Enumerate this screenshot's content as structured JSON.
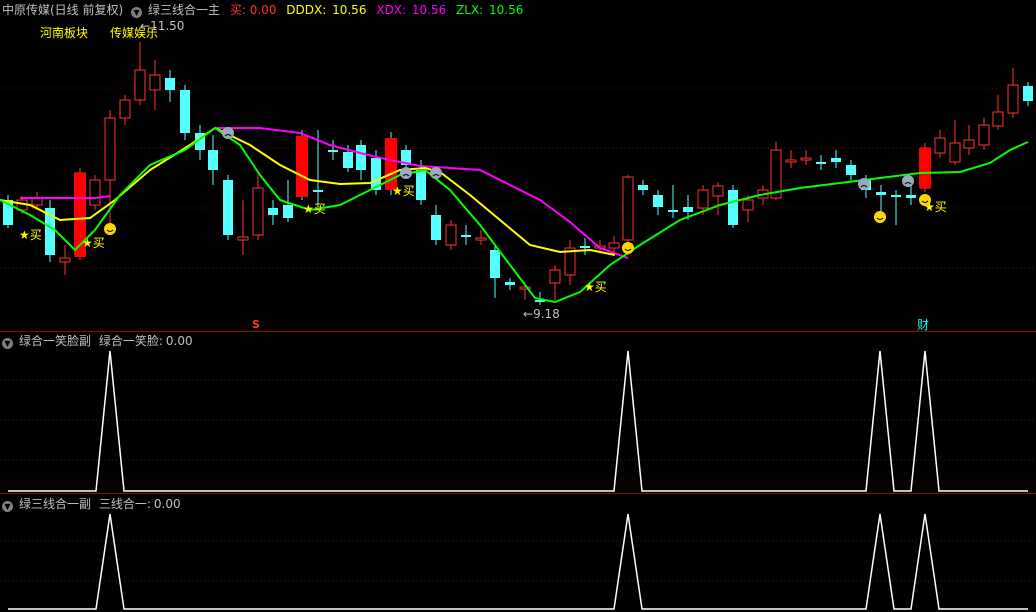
{
  "main_panel": {
    "stock_title": "中原传媒(日线 前复权)",
    "indicator_name": "绿三线合一主",
    "buy_label": "买:",
    "buy_value": "0.00",
    "dddx_label": "DDDX:",
    "dddx_value": "10.56",
    "xdx_label": "XDX:",
    "xdx_value": "10.56",
    "zlx_label": "ZLX:",
    "zlx_value": "10.56",
    "sector_tag_1": "河南板块",
    "sector_tag_2": "传媒娱乐",
    "high_price_label": "11.50",
    "low_price_label": "9.18",
    "signal_text": "买",
    "marker_s": "S",
    "marker_cai": "财"
  },
  "sub_panel_1": {
    "title": "绿合一笑脸副",
    "series_label": "绿合一笑脸:",
    "value": "0.00"
  },
  "sub_panel_2": {
    "title": "绿三线合一副",
    "series_label": "三线合一:",
    "value": "0.00"
  },
  "colors": {
    "up": "#ff3232",
    "down": "#54ffff",
    "dddx": "#ffff00",
    "xdx": "#ff00ff",
    "zlx": "#00ff00",
    "grid": "#800000",
    "separator": "#a00000"
  },
  "chart_data": [
    {
      "type": "candlestick",
      "title": "中原传媒(日线 前复权)",
      "y_range_approx": [
        9.0,
        11.6
      ],
      "highest": 11.5,
      "lowest": 9.18,
      "series": [
        {
          "name": "DDDX",
          "value": 10.56
        },
        {
          "name": "XDX",
          "value": 10.56
        },
        {
          "name": "ZLX",
          "value": 10.56
        }
      ],
      "annotations": [
        "买",
        "买",
        "买",
        "买",
        "买",
        "买",
        "河南板块",
        "传媒娱乐",
        "S",
        "财"
      ]
    },
    {
      "type": "line",
      "title": "绿合一笑脸副",
      "series": [
        {
          "name": "绿合一笑脸",
          "last_value": 0.0
        }
      ],
      "spikes_at_approx_bar": [
        12,
        63,
        89,
        94
      ]
    },
    {
      "type": "line",
      "title": "绿三线合一副",
      "series": [
        {
          "name": "三线合一",
          "last_value": 0.0
        }
      ],
      "spikes_at_approx_bar": [
        12,
        63,
        89,
        94
      ]
    }
  ]
}
